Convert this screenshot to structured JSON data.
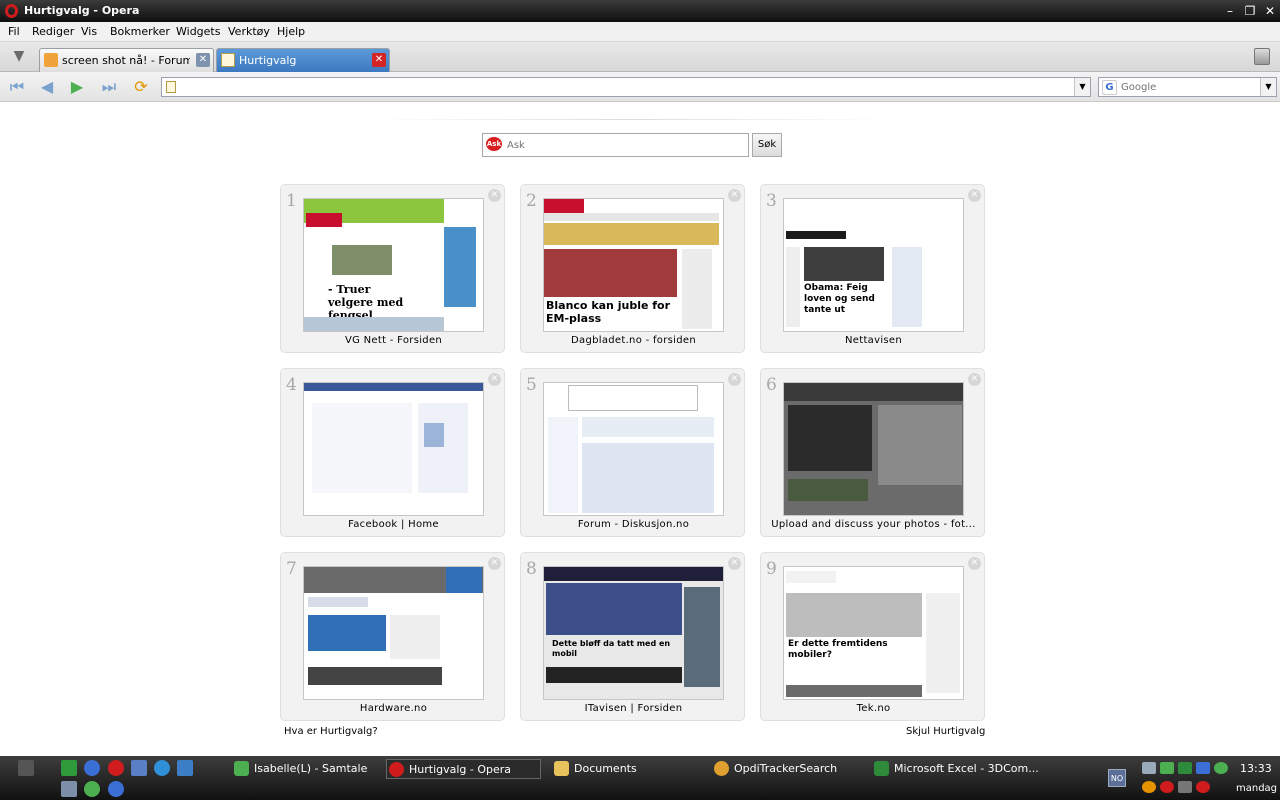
{
  "window": {
    "title": "Hurtigvalg - Opera"
  },
  "menu": [
    "Fil",
    "Rediger",
    "Vis",
    "Bokmerker",
    "Widgets",
    "Verktøy",
    "Hjelp"
  ],
  "tabs": [
    {
      "label": "screen shot nå! - Forum -...",
      "active": false
    },
    {
      "label": "Hurtigvalg",
      "active": true
    }
  ],
  "address": {
    "value": ""
  },
  "web_search": {
    "placeholder": "Google"
  },
  "ask": {
    "placeholder": "Ask",
    "logo": "Ask",
    "button": "Søk"
  },
  "speed_dial": [
    {
      "num": "1",
      "caption": "VG Nett - Forsiden",
      "thumb_bg": "#eaf0e1",
      "thumb_accent": "#8cc63f",
      "thumb_text": "- Truer velgere med fengsel"
    },
    {
      "num": "2",
      "caption": "Dagbladet.no - forsiden",
      "thumb_bg": "#f7f7f7",
      "thumb_accent": "#c8102e",
      "thumb_text": "Blanco kan juble for EM-plass"
    },
    {
      "num": "3",
      "caption": "Nettavisen",
      "thumb_bg": "#ffffff",
      "thumb_accent": "#d32f2f",
      "thumb_text": "Obama: Feig loven og send tante ut"
    },
    {
      "num": "4",
      "caption": "Facebook | Home",
      "thumb_bg": "#ffffff",
      "thumb_accent": "#3b5998",
      "thumb_text": ""
    },
    {
      "num": "5",
      "caption": "Forum - Diskusjon.no",
      "thumb_bg": "#ffffff",
      "thumb_accent": "#9ab6d9",
      "thumb_text": ""
    },
    {
      "num": "6",
      "caption": "Upload and discuss your photos - fot...",
      "thumb_bg": "#6b6b6b",
      "thumb_accent": "#3a3a3a",
      "thumb_text": ""
    },
    {
      "num": "7",
      "caption": "Hardware.no",
      "thumb_bg": "#ffffff",
      "thumb_accent": "#2f6fb5",
      "thumb_text": ""
    },
    {
      "num": "8",
      "caption": "ITavisen | Forsiden",
      "thumb_bg": "#1f1f3a",
      "thumb_accent": "#3d4f8a",
      "thumb_text": "Dette bløff da tatt med en mobil"
    },
    {
      "num": "9",
      "caption": "Tek.no",
      "thumb_bg": "#ffffff",
      "thumb_accent": "#6b6b6b",
      "thumb_text": "Er dette fremtidens mobiler?"
    }
  ],
  "links": {
    "help": "Hva er Hurtigvalg?",
    "hide": "Skjul Hurtigvalg"
  },
  "taskbar": {
    "tasks": [
      {
        "label": "Isabelle(L) - Samtale",
        "icon_color": "#4caf50",
        "active": false
      },
      {
        "label": "Hurtigvalg - Opera",
        "icon_color": "#d01c1c",
        "active": true
      },
      {
        "label": "Documents",
        "icon_color": "#e8c25a",
        "active": false
      },
      {
        "label": "OpdiTrackerSearch",
        "icon_color": "#e0a030",
        "active": false
      },
      {
        "label": "Microsoft Excel - 3DCom...",
        "icon_color": "#2e8b3a",
        "active": false
      }
    ],
    "lang": "NO",
    "time": "13:33",
    "day": "mandag"
  }
}
